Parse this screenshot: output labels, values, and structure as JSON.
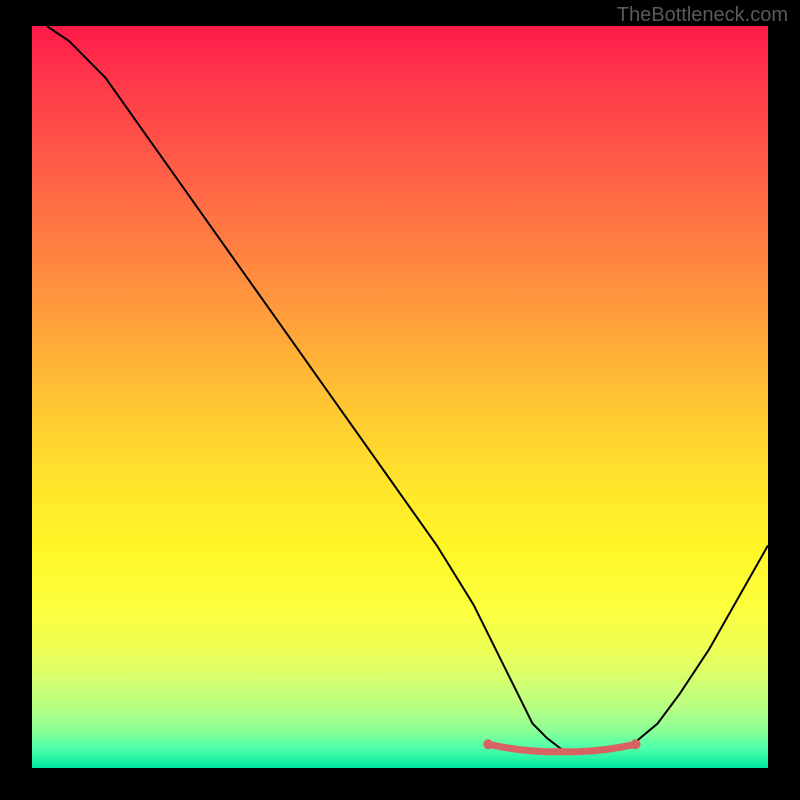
{
  "watermark": "TheBottleneck.com",
  "chart_data": {
    "type": "line",
    "title": "",
    "xlabel": "",
    "ylabel": "",
    "xlim": [
      0,
      100
    ],
    "ylim": [
      0,
      100
    ],
    "series": [
      {
        "name": "bottleneck-curve",
        "x": [
          2,
          5,
          10,
          15,
          20,
          25,
          30,
          35,
          40,
          45,
          50,
          55,
          60,
          62,
          64,
          66,
          68,
          70,
          72,
          74,
          76,
          78,
          80,
          82,
          85,
          88,
          92,
          96,
          100
        ],
        "y": [
          100,
          98,
          93,
          86,
          79,
          72,
          65,
          58,
          51,
          44,
          37,
          30,
          22,
          18,
          14,
          10,
          6,
          4,
          2.5,
          2,
          2,
          2.2,
          2.6,
          3.5,
          6,
          10,
          16,
          23,
          30
        ]
      }
    ],
    "optimal_band": {
      "name": "optimal-range",
      "x": [
        62,
        64,
        66,
        68,
        70,
        72,
        74,
        76,
        78,
        80,
        82
      ],
      "y": [
        3.2,
        2.8,
        2.5,
        2.3,
        2.2,
        2.2,
        2.2,
        2.3,
        2.5,
        2.8,
        3.2
      ]
    },
    "gradient": {
      "top_color": "#ff1a4a",
      "mid_color": "#ffd22f",
      "bottom_color": "#00e8a0"
    }
  }
}
